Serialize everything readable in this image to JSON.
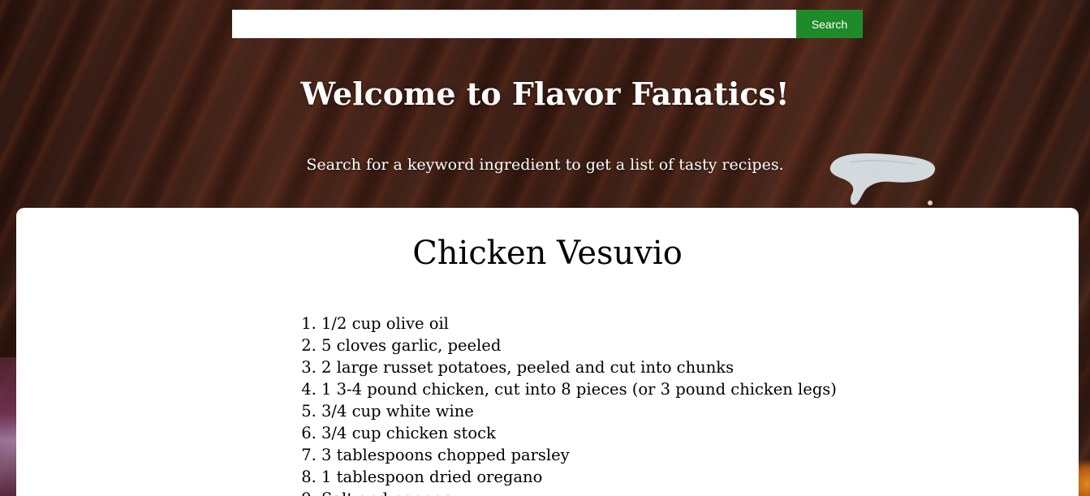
{
  "search": {
    "value": "",
    "placeholder": "",
    "button_label": "Search"
  },
  "hero": {
    "title": "Welcome to Flavor Fanatics!",
    "subtitle": "Search for a keyword ingredient to get a list of tasty recipes."
  },
  "recipe": {
    "title": "Chicken Vesuvio",
    "ingredients": [
      "1/2 cup olive oil",
      "5 cloves garlic, peeled",
      "2 large russet potatoes, peeled and cut into chunks",
      "1 3-4 pound chicken, cut into 8 pieces (or 3 pound chicken legs)",
      "3/4 cup white wine",
      "3/4 cup chicken stock",
      "3 tablespoons chopped parsley",
      "1 tablespoon dried oregano",
      "Salt and pepper"
    ]
  },
  "colors": {
    "search_button": "#1f8a2a",
    "card_background": "#ffffff",
    "hero_text": "#ffffff"
  }
}
